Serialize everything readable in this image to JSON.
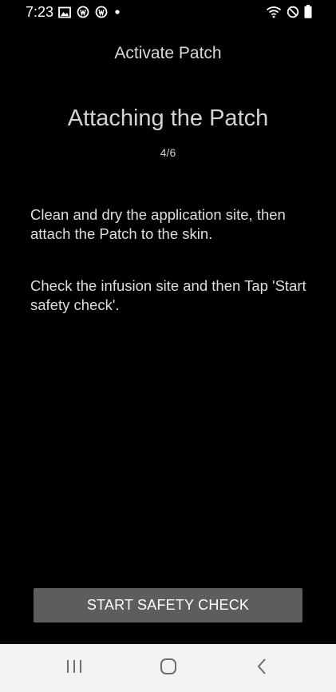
{
  "status_bar": {
    "time": "7:23",
    "left_icons": [
      "image-icon",
      "app-notification-icon",
      "app-notification-icon",
      "dot-icon"
    ],
    "right_icons": [
      "wifi-icon",
      "do-not-disturb-icon",
      "battery-icon"
    ]
  },
  "header": {
    "title": "Activate Patch"
  },
  "main": {
    "title": "Attaching the Patch",
    "step": "4/6",
    "instructions": [
      "Clean and dry the application site, then attach the Patch to the skin.",
      "Check the infusion site and then Tap 'Start safety check'."
    ]
  },
  "actions": {
    "start_label": "START SAFETY CHECK"
  },
  "nav_bar": {
    "buttons": [
      "recents-icon",
      "home-icon",
      "back-icon"
    ]
  },
  "colors": {
    "background": "#000000",
    "button": "#5d5d5d",
    "nav_bar": "#f2f2f2"
  }
}
